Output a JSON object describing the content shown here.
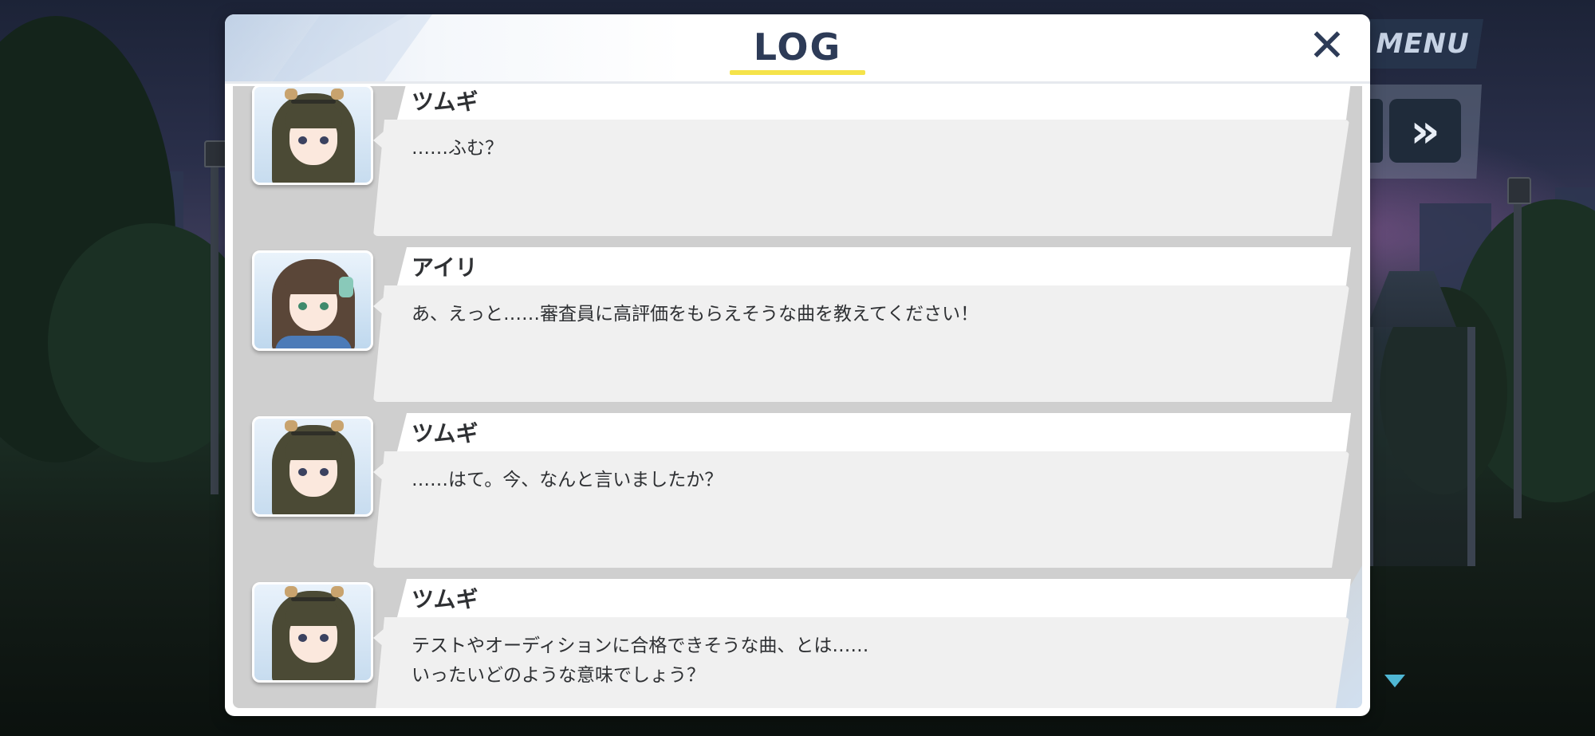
{
  "header": {
    "title": "LOG",
    "close_icon": "close-icon"
  },
  "controls": {
    "menu_label": "MENU",
    "skip_icon": "fast-forward-icon",
    "scroll_icon": "scroll-down-icon"
  },
  "colors": {
    "accent_underline": "#f5e34a",
    "title": "#2d3b57",
    "scroll_arrow": "#4fb7d4"
  },
  "log": [
    {
      "speaker": "ツムギ",
      "text": "……ふむ？"
    },
    {
      "speaker": "アイリ",
      "text": "あ、えっと……審査員に高評価をもらえそうな曲を教えてください！"
    },
    {
      "speaker": "ツムギ",
      "text": "……はて。今、なんと言いましたか？"
    },
    {
      "speaker": "ツムギ",
      "text": "テストやオーディションに合格できそうな曲、とは……\nいったいどのような意味でしょう？"
    }
  ]
}
